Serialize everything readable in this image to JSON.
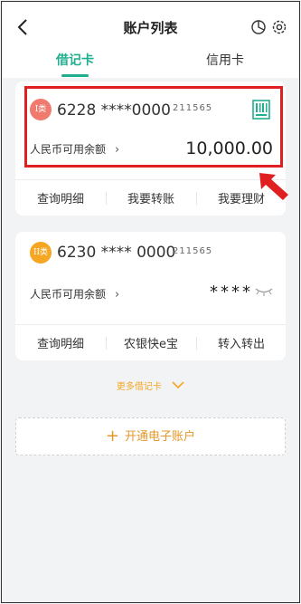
{
  "header": {
    "title": "账户列表",
    "back_icon": "chevron-left-icon",
    "right_icons": [
      "pie-chart-icon",
      "gear-icon"
    ]
  },
  "tabs": [
    {
      "label": "借记卡",
      "active": true
    },
    {
      "label": "信用卡",
      "active": false
    }
  ],
  "accent_color": "#1fae8e",
  "cards": [
    {
      "badge": "I类",
      "badge_color": "#f07a6e",
      "card_number": "6228 ****0000",
      "sub_number": "211565",
      "balance_label": "人民币可用余额",
      "balance": "10,000.00",
      "qr_icon": "qr-code-icon",
      "actions": [
        "查询明细",
        "我要转账",
        "我要理财"
      ]
    },
    {
      "badge": "II类",
      "badge_color": "#f5a623",
      "card_number": "6230 **** 0000",
      "sub_number": "211565",
      "balance_label": "人民币可用余额",
      "balance": "****",
      "eye_icon": "eye-closed-icon",
      "actions": [
        "查询明细",
        "农银快e宝",
        "转入转出"
      ]
    }
  ],
  "more_cards": "更多借记卡",
  "open_account": "开通电子账户",
  "annotation": {
    "highlight_color": "#e02020",
    "arrow_icon": "red-arrow-icon"
  }
}
